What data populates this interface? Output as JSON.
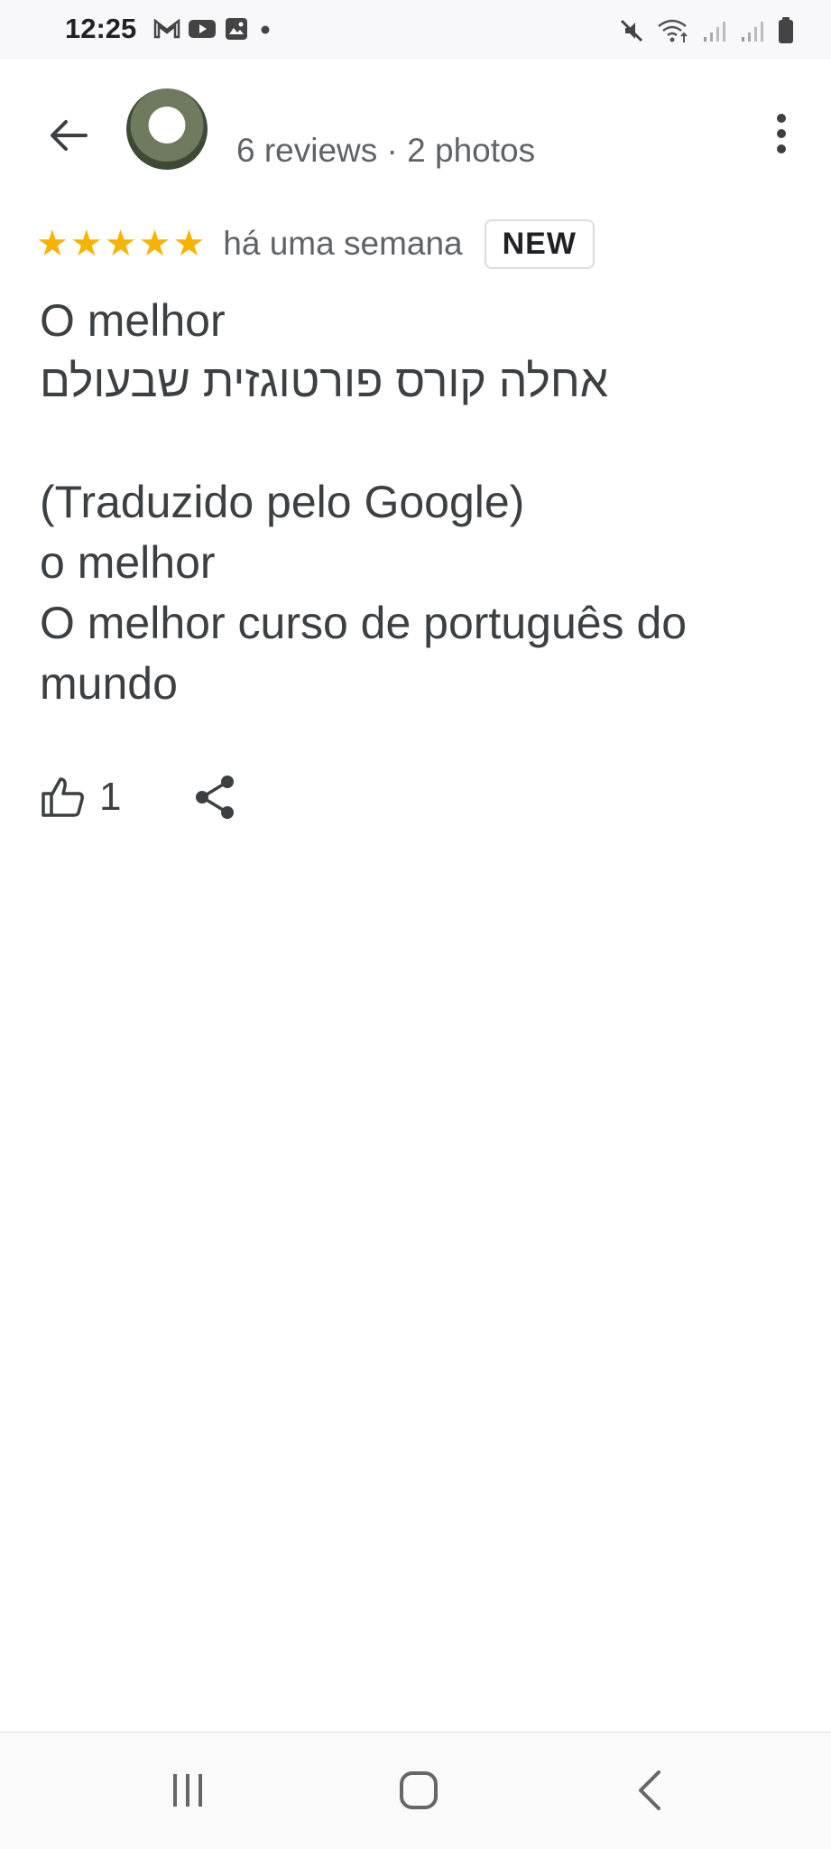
{
  "status_bar": {
    "time": "12:25",
    "left_icons": [
      "gmail-icon",
      "youtube-icon",
      "gallery-icon",
      "dot-icon"
    ],
    "right_icons": [
      "mute-icon",
      "wifi-icon",
      "signal-icon",
      "signal-icon",
      "battery-icon"
    ]
  },
  "header": {
    "reviewer_meta": "6 reviews · 2 photos"
  },
  "review": {
    "stars": 5,
    "time": "há uma semana",
    "badge": "NEW",
    "lines": [
      "O melhor",
      "אחלה קורס פורטוגזית שבעולם",
      "",
      "(Traduzido pelo Google)",
      "o melhor",
      "O melhor curso de português do",
      "mundo"
    ],
    "like_count": "1"
  },
  "colors": {
    "star": "#f6b400",
    "text": "#3c4043",
    "secondary_text": "#5f6368"
  }
}
